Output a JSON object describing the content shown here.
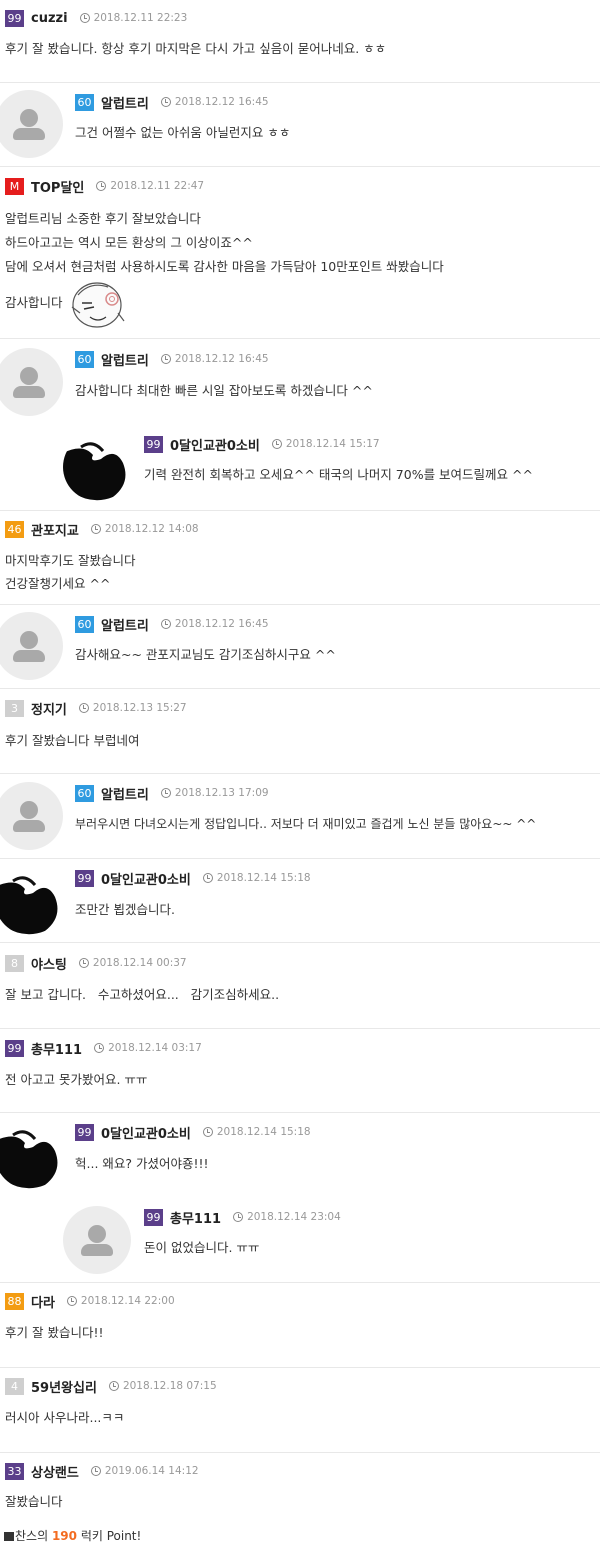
{
  "comments": [
    {
      "level": "99",
      "nick": "cuzzi",
      "date": "2018.12.11 22:23",
      "lines": [
        "후기 잘 봤습니다. 항상 후기 마지막은 다시 가고 싶음이 묻어나네요. ㅎㅎ"
      ]
    },
    {
      "level": "60",
      "nick": "알럽트리",
      "date": "2018.12.12 16:45",
      "lines": [
        "그건 어쩔수 없는 아쉬움 아닐런지요 ㅎㅎ"
      ]
    },
    {
      "level": "M",
      "nick": "TOP달인",
      "date": "2018.12.11 22:47",
      "lines": [
        "알럽트리님 소중한 후기 잘보았습니다",
        "하드아고고는 역시 모든 환상의 그 이상이죠^^",
        "담에 오셔서 현금처럼 사용하시도록 감사한 마음을 가득담아 10만포인트 쏴봤습니다",
        "감사합니다"
      ]
    },
    {
      "level": "60",
      "nick": "알럽트리",
      "date": "2018.12.12 16:45",
      "lines": [
        "감사합니다 최대한 빠른 시일 잡아보도록 하겠습니다 ^^"
      ]
    },
    {
      "level": "99",
      "nick": "0달인교관0소비",
      "date": "2018.12.14 15:17",
      "lines": [
        "기력 완전히 회복하고 오세요^^ 태국의 나머지 70%를 보여드릴께요 ^^"
      ]
    },
    {
      "level": "46",
      "nick": "관포지교",
      "date": "2018.12.12 14:08",
      "lines": [
        "마지막후기도 잘봤습니다",
        "건강잘챙기세요 ^^"
      ]
    },
    {
      "level": "60",
      "nick": "알럽트리",
      "date": "2018.12.12 16:45",
      "lines": [
        "감사해요~~ 관포지교님도 감기조심하시구요 ^^"
      ]
    },
    {
      "level": "3",
      "nick": "정지기",
      "date": "2018.12.13 15:27",
      "lines": [
        "후기 잘봤습니다 부럽네여"
      ]
    },
    {
      "level": "60",
      "nick": "알럽트리",
      "date": "2018.12.13 17:09",
      "lines": [
        "부러우시면 다녀오시는게 정답입니다.. 저보다 더 재미있고 즐겁게 노신 분들 많아요~~ ^^"
      ]
    },
    {
      "level": "99",
      "nick": "0달인교관0소비",
      "date": "2018.12.14 15:18",
      "lines": [
        "조만간 뵙겠습니다."
      ]
    },
    {
      "level": "8",
      "nick": "야스팅",
      "date": "2018.12.14 00:37",
      "lines": [
        "잘 보고 갑니다.   수고하셨어요...   감기조심하세요.."
      ]
    },
    {
      "level": "99",
      "nick": "총무111",
      "date": "2018.12.14 03:17",
      "lines": [
        "전 아고고 못가봤어요. ㅠㅠ"
      ]
    },
    {
      "level": "99",
      "nick": "0달인교관0소비",
      "date": "2018.12.14 15:18",
      "lines": [
        "헉... 왜요? 가셨어야죵!!!"
      ]
    },
    {
      "level": "99",
      "nick": "총무111",
      "date": "2018.12.14 23:04",
      "lines": [
        "돈이 없었습니다. ㅠㅠ"
      ]
    },
    {
      "level": "88",
      "nick": "다라",
      "date": "2018.12.14 22:00",
      "lines": [
        "후기 잘 봤습니다!!"
      ]
    },
    {
      "level": "4",
      "nick": "59년왕십리",
      "date": "2018.12.18 07:15",
      "lines": [
        "러시아 사우나라...ㅋㅋ"
      ]
    },
    {
      "level": "33",
      "nick": "상상랜드",
      "date": "2019.06.14 14:12",
      "lines": [
        "잘봤습니다"
      ]
    }
  ],
  "footer": {
    "prefix": "찬스의 ",
    "points": "190",
    "suffix": " 럭키 Point!"
  },
  "colors": {
    "purple": "#5b3f8a",
    "blue": "#2f9be0",
    "red": "#e51d1d",
    "orange": "#f39c12",
    "grey": "#cfcfcf",
    "points": "#f36c21"
  }
}
